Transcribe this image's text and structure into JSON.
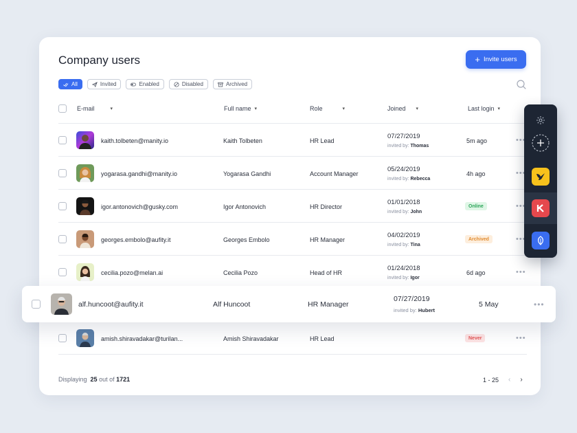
{
  "page": {
    "title": "Company users",
    "invite_label": "Invite users"
  },
  "filters": [
    {
      "label": "All",
      "icon": "double-check-icon",
      "active": true
    },
    {
      "label": "Invited",
      "icon": "paper-plane-icon",
      "active": false
    },
    {
      "label": "Enabled",
      "icon": "toggle-icon",
      "active": false
    },
    {
      "label": "Disabled",
      "icon": "ban-icon",
      "active": false
    },
    {
      "label": "Archived",
      "icon": "archive-icon",
      "active": false
    }
  ],
  "table": {
    "columns": {
      "email": "E-mail",
      "full_name": "Full name",
      "role": "Role",
      "joined": "Joined",
      "last_login": "Last login"
    },
    "invited_by_prefix": "invited by:",
    "rows": [
      {
        "email": "kaith.tolbeten@manity.io",
        "name": "Kaith Tolbeten",
        "role": "HR Lead",
        "joined": "07/27/2019",
        "invited_by": "Thomas",
        "last_login": "5m ago",
        "badge": null
      },
      {
        "email": "yogarasa.gandhi@manity.io",
        "name": "Yogarasa Gandhi",
        "role": "Account Manager",
        "joined": "05/24/2019",
        "invited_by": "Rebecca",
        "last_login": "4h ago",
        "badge": null
      },
      {
        "email": "igor.antonovich@gusky.com",
        "name": "Igor Antonovich",
        "role": "HR Director",
        "joined": "01/01/2018",
        "invited_by": "John",
        "last_login": "",
        "badge": "Online"
      },
      {
        "email": "georges.embolo@aufity.it",
        "name": "Georges Embolo",
        "role": "HR Manager",
        "joined": "04/02/2019",
        "invited_by": "Tina",
        "last_login": "",
        "badge": "Archived"
      },
      {
        "email": "cecilia.pozo@melan.ai",
        "name": "Cecilia Pozo",
        "role": "Head of HR",
        "joined": "01/24/2018",
        "invited_by": "Igor",
        "last_login": "6d ago",
        "badge": null
      },
      {
        "email": "amish.shiravadakar@turilan...",
        "name": "Amish Shiravadakar",
        "role": "HR Lead",
        "joined": "",
        "invited_by": "",
        "last_login": "",
        "badge": "Never"
      }
    ],
    "highlighted": {
      "email": "alf.huncoot@aufity.it",
      "name": "Alf Huncoot",
      "role": "HR Manager",
      "joined": "07/27/2019",
      "invited_by": "Hubert",
      "last_login": "5 May"
    }
  },
  "footer": {
    "displaying_label": "Displaying",
    "count": "25",
    "out_of_label": "out of",
    "total": "1721",
    "range": "1 - 25"
  },
  "colors": {
    "accent": "#3a6df0",
    "online": "#2da55a",
    "archived": "#e18b2f",
    "never": "#e45757",
    "dock": "#1d2533"
  }
}
